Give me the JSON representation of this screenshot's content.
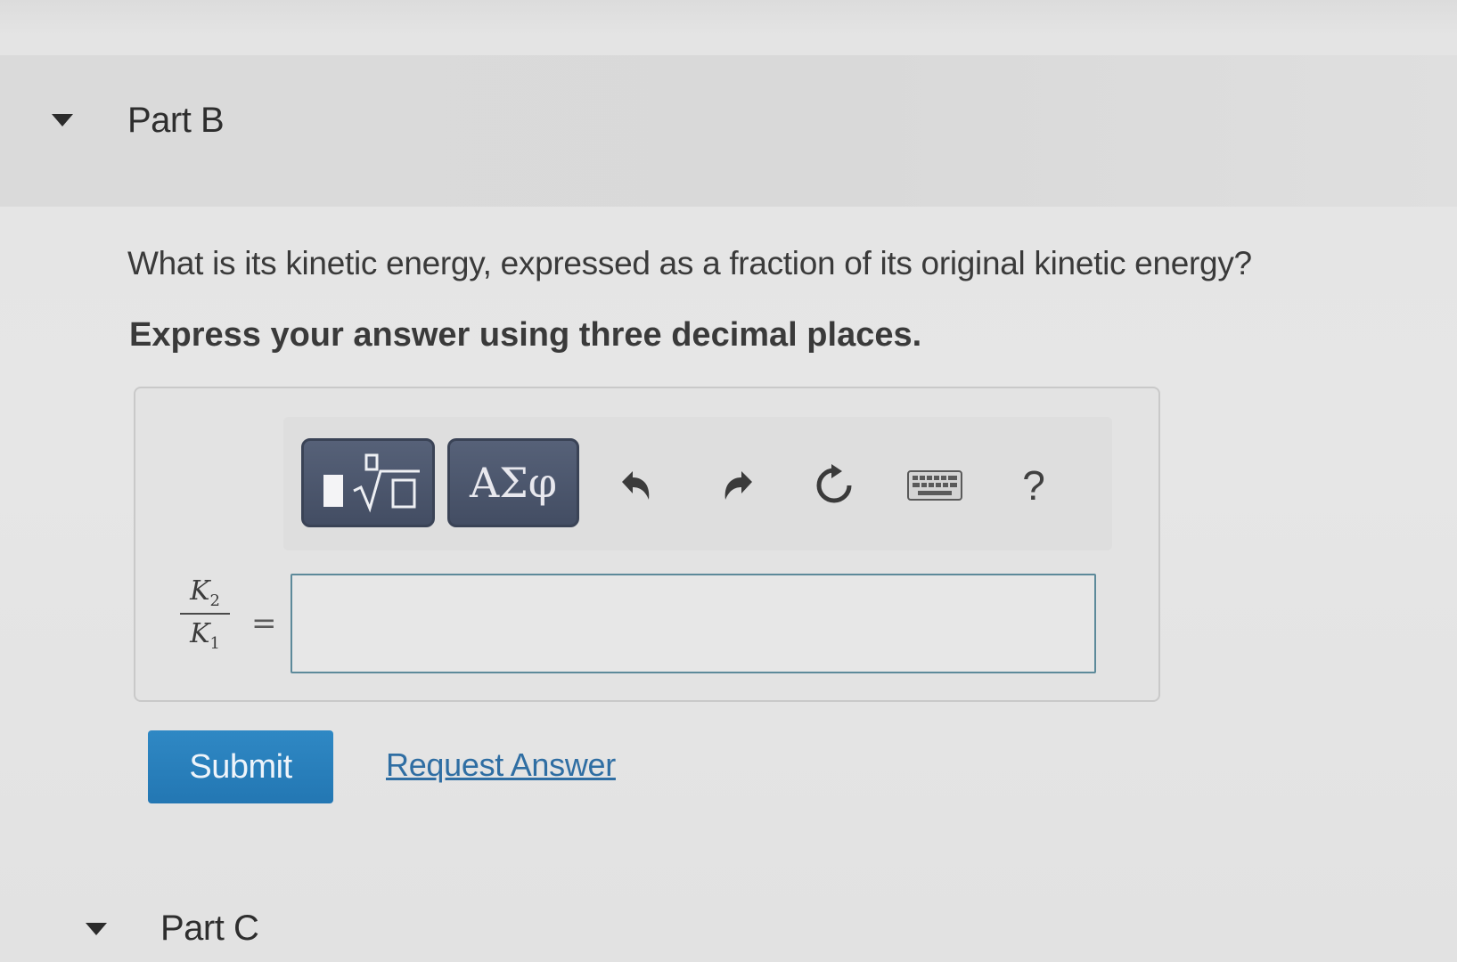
{
  "part_b": {
    "title": "Part B",
    "question": "What is its kinetic energy, expressed as a fraction of its original kinetic energy?",
    "instruction": "Express your answer using three decimal places."
  },
  "toolbar": {
    "templates_icon": "templates-sqrt-icon",
    "symbols_label": "ΑΣφ",
    "undo_icon": "undo-icon",
    "redo_icon": "redo-icon",
    "reset_icon": "reset-icon",
    "keyboard_icon": "keyboard-icon",
    "help_label": "?"
  },
  "answer": {
    "numerator": "K",
    "numerator_sub": "2",
    "denominator": "K",
    "denominator_sub": "1",
    "equals": "=",
    "value": ""
  },
  "actions": {
    "submit_label": "Submit",
    "request_label": "Request Answer"
  },
  "part_c": {
    "title": "Part C"
  },
  "colors": {
    "submit": "#2b82bf",
    "link": "#2f6ea3",
    "toolbar_button": "#4a5469"
  }
}
